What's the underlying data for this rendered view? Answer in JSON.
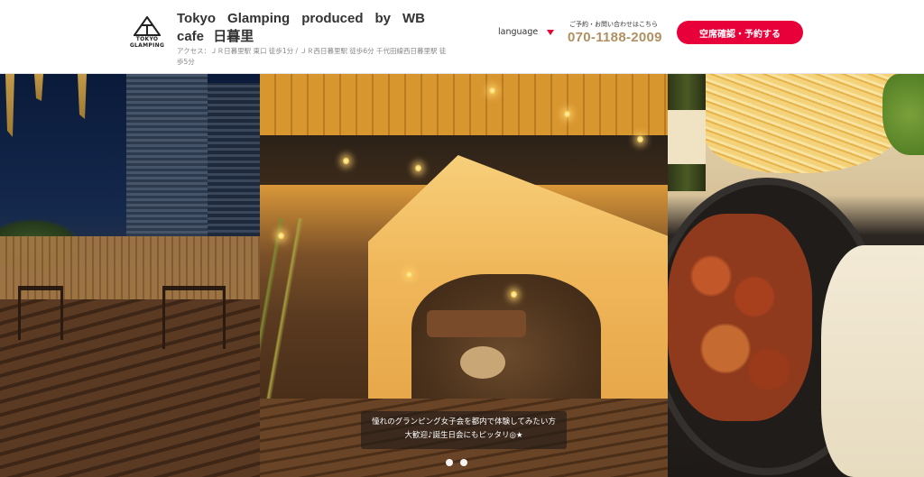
{
  "header": {
    "logo_text_line1": "TOKYO",
    "logo_text_line2": "GLAMPING",
    "brand_title": "Tokyo Glamping produced by WB cafe 日暮里",
    "access": "アクセス：ＪＲ日暮里駅 東口 徒歩1分 / ＪＲ西日暮里駅 徒歩6分 千代田線西日暮里駅 徒歩5分",
    "language_label": "language",
    "contact_label": "ご予約・お問い合わせはこちら",
    "phone": "070-1188-2009",
    "reserve_label": "空席確認・予約する"
  },
  "hero": {
    "caption_line1": "憧れのグランピング女子会を都内で体験してみたい方",
    "caption_line2": "大歓迎♪誕生日会にもピッタリ◎★",
    "slides_total": 2,
    "active_slide": 2
  },
  "colors": {
    "accent": "#e8003a",
    "phone": "#b09060",
    "lang_caret": "#e60033"
  },
  "icons": {
    "logo": "tokyo-glamping-logo",
    "language": "caret-down-icon"
  }
}
